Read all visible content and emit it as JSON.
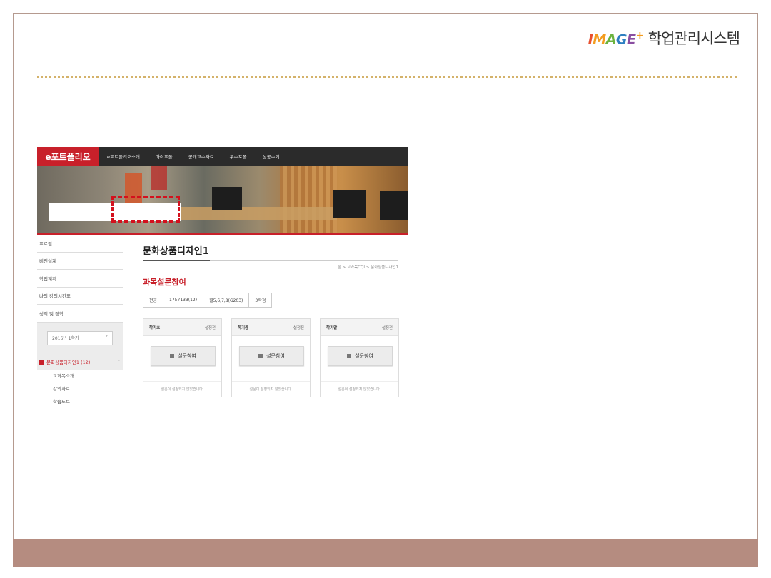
{
  "slide": {
    "logo_image_text": "IMAGE",
    "logo_plus": "+",
    "logo_title": "학업관리시스템",
    "colors": {
      "footer_bar": "#b58c80",
      "dotted_rule": "#d4b26a",
      "highlight": "#d4101d",
      "accent": "#c8202a"
    }
  },
  "site": {
    "brand": "e포트폴리오",
    "nav": [
      "e포트폴리오소개",
      "마이포폴",
      "공개교수자료",
      "우수포폴",
      "성공수기"
    ]
  },
  "sidebar": {
    "items": [
      "프로필",
      "비전설계",
      "학업계획",
      "나의 강의시간표",
      "성적 및 장학"
    ],
    "semester_select": "2016년 1학기",
    "course": "문화상품디자인1 (12)",
    "sub_items": [
      "교과목소개",
      "강의자료",
      "학습노트"
    ]
  },
  "content": {
    "course_title": "문화상품디자인1",
    "breadcrumb": "홈 > 교과목CQI > 문화상품디자인1",
    "section_title": "과목설문참여",
    "info": [
      "전공",
      "1757133(12)",
      "월5,6,7,8(G203)",
      "3학점"
    ],
    "cards": [
      {
        "title": "학기초",
        "status": "설정전",
        "button": "설문참여",
        "footer": "설문이 설정되지 않았습니다."
      },
      {
        "title": "학기중",
        "status": "설정전",
        "button": "설문참여",
        "footer": "설문이 설정되지 않았습니다."
      },
      {
        "title": "학기말",
        "status": "설정전",
        "button": "설문참여",
        "footer": "설문이 설정되지 않았습니다."
      }
    ]
  }
}
